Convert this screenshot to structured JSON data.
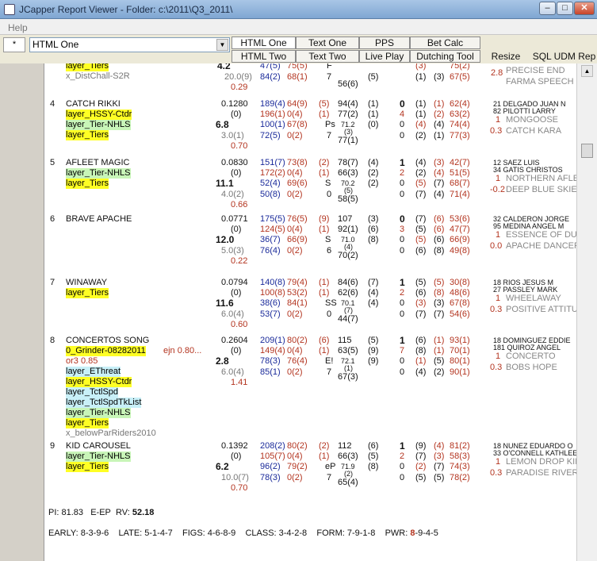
{
  "window": {
    "title": "JCapper Report Viewer - Folder: c:\\2011\\Q3_2011\\"
  },
  "menu": {
    "help": "Help"
  },
  "toolbar": {
    "star": "*",
    "combo_value": "HTML One",
    "row1": [
      "HTML One",
      "Text One",
      "PPS",
      "Bet Calc"
    ],
    "row2": [
      "HTML Two",
      "Text Two",
      "Live Play",
      "Dutching Tool",
      "Resize",
      "SQL UDM Rep"
    ]
  },
  "colors": {
    "highlight_yellow": "#ffff24",
    "highlight_green": "#c8f5b8",
    "highlight_cyan": "#c8f0f8",
    "blue_text": "#1a2a9a",
    "red_text": "#b3341f"
  },
  "partial_top": {
    "layer": "layer_Tiers",
    "rider": "x_DistChall-S2R",
    "odds": "4.2",
    "c1": "47(5)",
    "c2": "75(5)",
    "ml": "20.0(9)",
    "c3": "84(2)",
    "c4": "68(1)",
    "fp": "0.29",
    "run": "F",
    "rr": "7",
    "d1": "56(6)",
    "cr": "5",
    "t1": "(5)",
    "u": "(3)",
    "j1": "(1)",
    "j2": "75(2)",
    "j3": "(1)",
    "j4": "(3)",
    "j5": "67(5)",
    "od": "2.8",
    "sire": "PRECISE END",
    "dam": "FARMA SPEECH"
  },
  "horses": [
    {
      "num": "4",
      "name": "CATCH RIKKI",
      "layers": [
        {
          "t": "layer_HSSY-Ctdr",
          "c": "y"
        },
        {
          "t": "layer_Tier-NHLS",
          "c": "g"
        },
        {
          "t": "layer_Tiers",
          "c": "y"
        }
      ],
      "pv": "0.1280",
      "pr": "(0)",
      "odds": "6.8",
      "ml": "3.0(1)",
      "fp": "0.70",
      "c1": "189(4)",
      "c2": "196(1)",
      "c3": "100(1)",
      "c4": "72(5)",
      "d1": "64(9)",
      "d2": "0(4)",
      "d3": "67(8)",
      "d4": "0(2)",
      "e1": "(5)",
      "e2": "(1)",
      "e3": "Ps",
      "e4": "7",
      "f1": "94(4)",
      "f2": "77(2)",
      "f3": "71.2",
      "f3b": "(3)",
      "f4": "77(1)",
      "g1": "(1)",
      "g2": "(1)",
      "g3": "(0)",
      "h1": "0",
      "h2": "4",
      "h3": "0",
      "h4": "0",
      "i1": "(1)",
      "i2": "(1)",
      "i3": "(4)",
      "i4": "(2)",
      "j1": "(1)",
      "j2": "(2)",
      "j3": "(4)",
      "j4": "(1)",
      "k1": "62(4)",
      "k2": "63(2)",
      "k3": "74(4)",
      "k4": "77(3)",
      "jockey": "21 DELGADO JUAN N",
      "trainer": "82 PILOTTI LARRY",
      "o1": "1",
      "o2": "0.3",
      "sire": "MONGOOSE",
      "dam": "CATCH KARA"
    },
    {
      "num": "5",
      "name": "AFLEET MAGIC",
      "layers": [
        {
          "t": "layer_Tier-NHLS",
          "c": "g"
        },
        {
          "t": "layer_Tiers",
          "c": "y"
        }
      ],
      "pv": "0.0830",
      "pr": "(0)",
      "odds": "11.1",
      "ml": "4.0(2)",
      "fp": "0.66",
      "c1": "151(7)",
      "c2": "172(2)",
      "c3": "52(4)",
      "c4": "50(8)",
      "d1": "73(8)",
      "d2": "0(4)",
      "d3": "69(6)",
      "d4": "0(2)",
      "e1": "(2)",
      "e2": "(1)",
      "e3": "S",
      "e4": "0",
      "f1": "78(7)",
      "f2": "66(3)",
      "f3": "70.2",
      "f3b": "(5)",
      "f4": "58(5)",
      "g1": "(4)",
      "g2": "(2)",
      "g3": "(2)",
      "h1": "1",
      "h2": "2",
      "h3": "0",
      "h4": "0",
      "i1": "(4)",
      "i2": "(2)",
      "i3": "(5)",
      "i4": "(7)",
      "j1": "(3)",
      "j2": "(4)",
      "j3": "(7)",
      "j4": "(4)",
      "k1": "42(7)",
      "k2": "51(5)",
      "k3": "68(7)",
      "k4": "71(4)",
      "jockey": "12 SAEZ LUIS",
      "trainer": "34 GATIS CHRISTOS",
      "o1": "1",
      "o2": "-0.2",
      "sire": "NORTHERN AFLEET",
      "dam": "DEEP BLUE SKIES"
    },
    {
      "num": "6",
      "name": "BRAVE APACHE",
      "layers": [],
      "pv": "0.0771",
      "pr": "(0)",
      "odds": "12.0",
      "ml": "5.0(3)",
      "fp": "0.22",
      "c1": "175(5)",
      "c2": "124(5)",
      "c3": "36(7)",
      "c4": "76(4)",
      "d1": "76(5)",
      "d2": "0(4)",
      "d3": "66(9)",
      "d4": "0(2)",
      "e1": "(9)",
      "e2": "(1)",
      "e3": "S",
      "e4": "6",
      "f1": "107",
      "f2": "92(1)",
      "f3": "71.0",
      "f3b": "(4)",
      "f4": "70(2)",
      "g1": "(3)",
      "g2": "(6)",
      "g3": "(8)",
      "h1": "0",
      "h2": "3",
      "h3": "0",
      "h4": "0",
      "i1": "(7)",
      "i2": "(5)",
      "i3": "(5)",
      "i4": "(6)",
      "j1": "(6)",
      "j2": "(6)",
      "j3": "(6)",
      "j4": "(8)",
      "k1": "53(6)",
      "k2": "47(7)",
      "k3": "66(9)",
      "k4": "49(8)",
      "jockey": "32 CALDERON JORGE",
      "trainer": "95 MEDINA ANGEL M",
      "o1": "1",
      "o2": "0.0",
      "sire": "ESSENCE OF DUBAI",
      "dam": "APACHE DANCER"
    },
    {
      "num": "7",
      "name": "WINAWAY",
      "layers": [
        {
          "t": "layer_Tiers",
          "c": "y"
        }
      ],
      "pv": "0.0794",
      "pr": "(0)",
      "odds": "11.6",
      "ml": "6.0(4)",
      "fp": "0.60",
      "c1": "140(8)",
      "c2": "100(8)",
      "c3": "38(6)",
      "c4": "53(7)",
      "d1": "79(4)",
      "d2": "53(2)",
      "d3": "84(1)",
      "d4": "0(2)",
      "e1": "(1)",
      "e2": "(1)",
      "e3": "SS",
      "e4": "0",
      "f1": "84(6)",
      "f2": "62(6)",
      "f3": "70.1",
      "f3b": "(7)",
      "f4": "44(7)",
      "g1": "(7)",
      "g2": "(4)",
      "g3": "(4)",
      "h1": "1",
      "h2": "2",
      "h3": "0",
      "h4": "0",
      "i1": "(5)",
      "i2": "(6)",
      "i3": "(3)",
      "i4": "(7)",
      "j1": "(5)",
      "j2": "(8)",
      "j3": "(3)",
      "j4": "(7)",
      "k1": "30(8)",
      "k2": "48(6)",
      "k3": "67(8)",
      "k4": "54(6)",
      "jockey": "18 RIOS JESUS M",
      "trainer": "27 PASSLEY MARK",
      "o1": "1",
      "o2": "0.3",
      "sire": "WHEELAWAY",
      "dam": "POSITIVE ATTITUDE"
    },
    {
      "num": "8",
      "name": "CONCERTOS SONG",
      "layers": [
        {
          "t": "0_Grinder-08282011",
          "c": "y",
          "extra": "ejn 0.80..."
        },
        {
          "t": "or3 0.85",
          "c": "redtxt"
        },
        {
          "t": "layer_EThreat",
          "c": "c"
        },
        {
          "t": "layer_HSSY-Ctdr",
          "c": "y"
        },
        {
          "t": "layer_TctlSpd",
          "c": "c"
        },
        {
          "t": "layer_TctlSpdTkList",
          "c": "c"
        },
        {
          "t": "layer_Tier-NHLS",
          "c": "g"
        },
        {
          "t": "layer_Tiers",
          "c": "y"
        },
        {
          "t": "x_belowParRiders2010",
          "c": "gray"
        }
      ],
      "pv": "0.2604",
      "pr": "(0)",
      "odds": "2.8",
      "ml": "6.0(4)",
      "fp": "1.41",
      "c1": "209(1)",
      "c2": "149(4)",
      "c3": "78(3)",
      "c4": "85(1)",
      "d1": "80(2)",
      "d2": "0(4)",
      "d3": "76(4)",
      "d4": "0(2)",
      "e1": "(6)",
      "e2": "(1)",
      "e3": "E!",
      "e4": "7",
      "f1": "115",
      "f2": "63(5)",
      "f3": "72.1",
      "f3b": "(1)",
      "f4": "67(3)",
      "g1": "(5)",
      "g2": "(9)",
      "g3": "(9)",
      "h1": "1",
      "h2": "7",
      "h3": "0",
      "h4": "0",
      "i1": "(6)",
      "i2": "(8)",
      "i3": "(1)",
      "i4": "(4)",
      "j1": "(1)",
      "j2": "(1)",
      "j3": "(5)",
      "j4": "(2)",
      "k1": "93(1)",
      "k2": "70(1)",
      "k3": "80(1)",
      "k4": "90(1)",
      "jockey": "18 DOMINGUEZ EDDIE",
      "trainer": "181 QUIROZ ANGEL",
      "o1": "1",
      "o2": "0.3",
      "sire": "CONCERTO",
      "dam": "BOBS HOPE"
    },
    {
      "num": "9",
      "name": "KID CAROUSEL",
      "layers": [
        {
          "t": "layer_Tier-NHLS",
          "c": "g"
        },
        {
          "t": "layer_Tiers",
          "c": "y"
        }
      ],
      "pv": "0.1392",
      "pr": "(0)",
      "odds": "6.2",
      "ml": "10.0(7)",
      "fp": "0.70",
      "c1": "208(2)",
      "c2": "105(7)",
      "c3": "96(2)",
      "c4": "78(3)",
      "d1": "80(2)",
      "d2": "0(4)",
      "d3": "79(2)",
      "d4": "0(2)",
      "e1": "(2)",
      "e2": "(1)",
      "e3": "eP",
      "e4": "7",
      "f1": "112",
      "f2": "66(3)",
      "f3": "71.9",
      "f3b": "(2)",
      "f4": "65(4)",
      "g1": "(6)",
      "g2": "(5)",
      "g3": "(8)",
      "h1": "1",
      "h2": "2",
      "h3": "0",
      "h4": "0",
      "i1": "(9)",
      "i2": "(7)",
      "i3": "(2)",
      "i4": "(5)",
      "j1": "(4)",
      "j2": "(3)",
      "j3": "(7)",
      "j4": "(5)",
      "k1": "81(2)",
      "k2": "58(3)",
      "k3": "74(3)",
      "k4": "78(2)",
      "jockey": "18 NUNEZ EDUARDO O",
      "trainer": "33 O'CONNELL KATHLEEN",
      "o1": "1",
      "o2": "0.3",
      "sire": "LEMON DROP KID",
      "dam": "PARADISE RIVER"
    }
  ],
  "footer": {
    "pi": "PI: 81.83",
    "eep": "E-EP",
    "rv_label": "RV:",
    "rv": "52.18",
    "early": "EARLY: 8-3-9-6",
    "late": "LATE: 5-1-4-7",
    "figs": "FIGS: 4-6-8-9",
    "class": "CLASS: 3-4-2-8",
    "form": "FORM: 7-9-1-8",
    "pwr_label": "PWR:",
    "pwr_first": "8",
    "pwr_rest": "-9-4-5"
  }
}
